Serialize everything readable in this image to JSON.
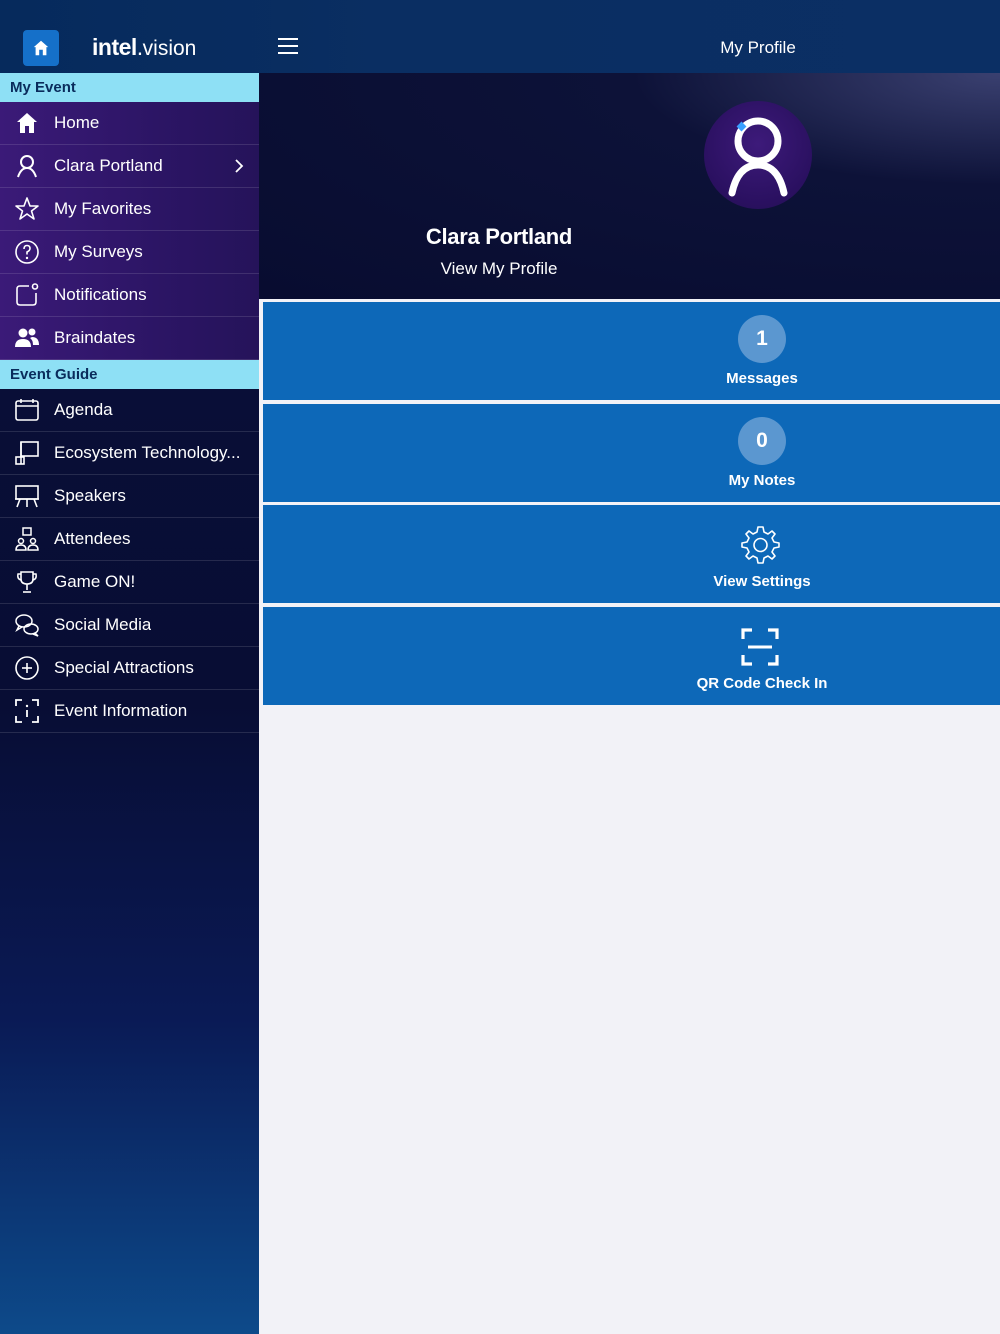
{
  "header": {
    "logo_intel": "intel",
    "logo_dot": ".",
    "logo_vision": "vision",
    "title": "My Profile"
  },
  "sidebar": {
    "sections": [
      {
        "title": "My Event",
        "items": [
          {
            "label": "Home",
            "icon": "home-icon"
          },
          {
            "label": "Clara Portland",
            "icon": "user-icon"
          },
          {
            "label": "My Favorites",
            "icon": "star-icon"
          },
          {
            "label": "My Surveys",
            "icon": "question-icon"
          },
          {
            "label": "Notifications",
            "icon": "notification-icon"
          },
          {
            "label": "Braindates",
            "icon": "people-icon"
          }
        ]
      },
      {
        "title": "Event Guide",
        "items": [
          {
            "label": "Agenda",
            "icon": "calendar-icon"
          },
          {
            "label": "Ecosystem Technology...",
            "icon": "booth-icon"
          },
          {
            "label": "Speakers",
            "icon": "podium-icon"
          },
          {
            "label": "Attendees",
            "icon": "attendees-icon"
          },
          {
            "label": "Game ON!",
            "icon": "trophy-icon"
          },
          {
            "label": "Social Media",
            "icon": "chat-icon"
          },
          {
            "label": "Special Attractions",
            "icon": "plus-circle-icon"
          },
          {
            "label": "Event Information",
            "icon": "info-frame-icon"
          }
        ]
      }
    ]
  },
  "profile": {
    "name": "Clara Portland",
    "link": "View My Profile"
  },
  "tiles": [
    {
      "label": "Messages",
      "count": "1"
    },
    {
      "label": "My Notes",
      "count": "0"
    },
    {
      "label": "View Settings",
      "icon": "gear-icon"
    },
    {
      "label": "QR Code Check In",
      "icon": "qr-scan-icon"
    }
  ],
  "colors": {
    "accent": "#0d68b8",
    "section_header": "#8ee0f5",
    "topbar": "#0a2e62"
  }
}
